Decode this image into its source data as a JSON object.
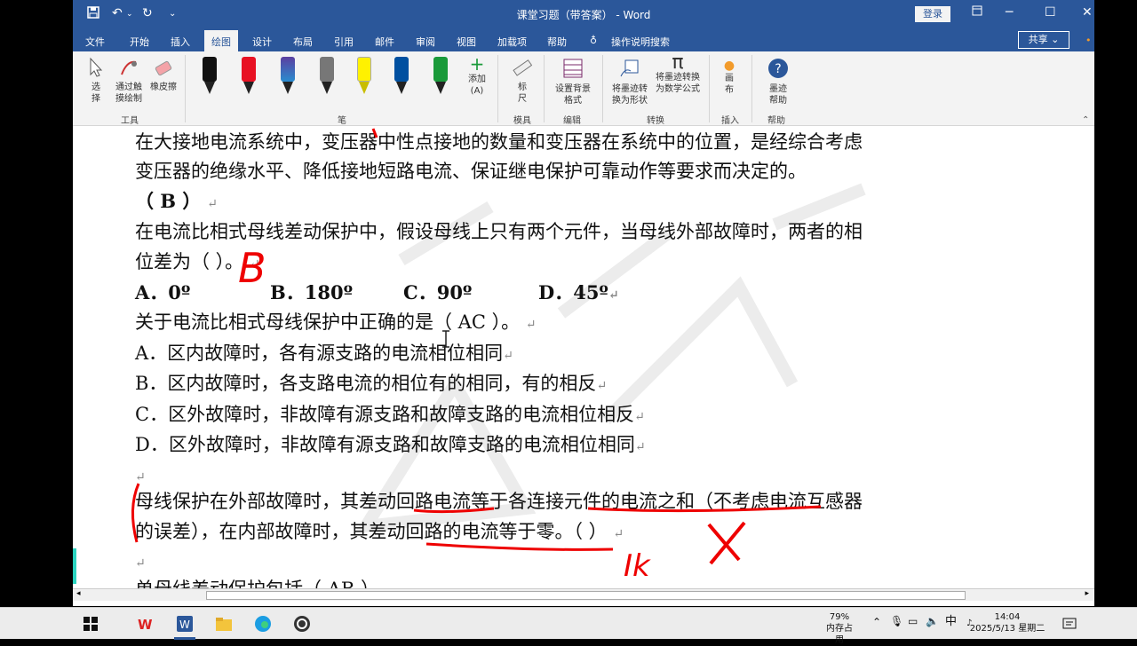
{
  "titlebar": {
    "doc_title": "课堂习题（带答案） - Word",
    "login": "登录"
  },
  "tabs": [
    "文件",
    "开始",
    "插入",
    "绘图",
    "设计",
    "布局",
    "引用",
    "邮件",
    "审阅",
    "视图",
    "加载项",
    "帮助"
  ],
  "tell_me": "操作说明搜索",
  "share": "共享",
  "ribbon": {
    "tools": {
      "select": "选择",
      "touch_draw": "通过触摸绘制",
      "eraser": "橡皮擦",
      "group": "工具"
    },
    "pens": {
      "add": "添加",
      "add_sub": "(A)",
      "group": "笔",
      "colors": [
        "#111111",
        "#e81123",
        "#6b5aa8",
        "#777777",
        "#fff100",
        "#0050a0",
        "#1a9a3a"
      ]
    },
    "stencils": {
      "ruler": "标尺",
      "group": "模具"
    },
    "edit": {
      "bg": "设置背景格式",
      "group": "编辑"
    },
    "convert": {
      "to_shape": "将墨迹转换为形状",
      "to_math": "将墨迹转换为数学公式",
      "group": "转换"
    },
    "insert": {
      "canvas": "画布",
      "group": "插入"
    },
    "help": {
      "ink_help": "墨迹帮助",
      "group": "帮助"
    }
  },
  "doc": {
    "line1": "在大接地电流系统中，变压器中性点接地的数量和变压器在系统中的位置，是经综合考虑",
    "line2": "变压器的绝缘水平、降低接地短路电流、保证继电保护可靠动作等要求而决定的。",
    "line3": "（ B ）",
    "line4": "在电流比相式母线差动保护中，假设母线上只有两个元件，当母线外部故障时，两者的相",
    "line5": "位差为（     ）。",
    "opt_a": "A．0º",
    "opt_b": "B．180º",
    "opt_c": "C．90º",
    "opt_d": "D．45º",
    "line7": "关于电流比相式母线保护中正确的是（  AC  ）。",
    "line8": "A．区内故障时，各有源支路的电流相位相同",
    "line9": "B．区内故障时，各支路电流的相位有的相同，有的相反",
    "line10": "C．区外故障时，非故障有源支路和故障支路的电流相位相反",
    "line11": "D．区外故障时，非故障有源支路和故障支路的电流相位相同",
    "line12": "母线保护在外部故障时，其差动回路电流等于各连接元件的电流之和（不考虑电流互感器",
    "line13": "的误差），在内部故障时，其差动回路的电流等于零。（      ）",
    "line14": "单母线差动保护包括（  AB  ）"
  },
  "handwriting": {
    "b_mark": "B",
    "ik": "Ik"
  },
  "taskbar": {
    "mem_pct": "79%",
    "mem_label": "内存占用",
    "ime": "中",
    "time": "14:04",
    "date": "2025/5/13 星期二"
  }
}
